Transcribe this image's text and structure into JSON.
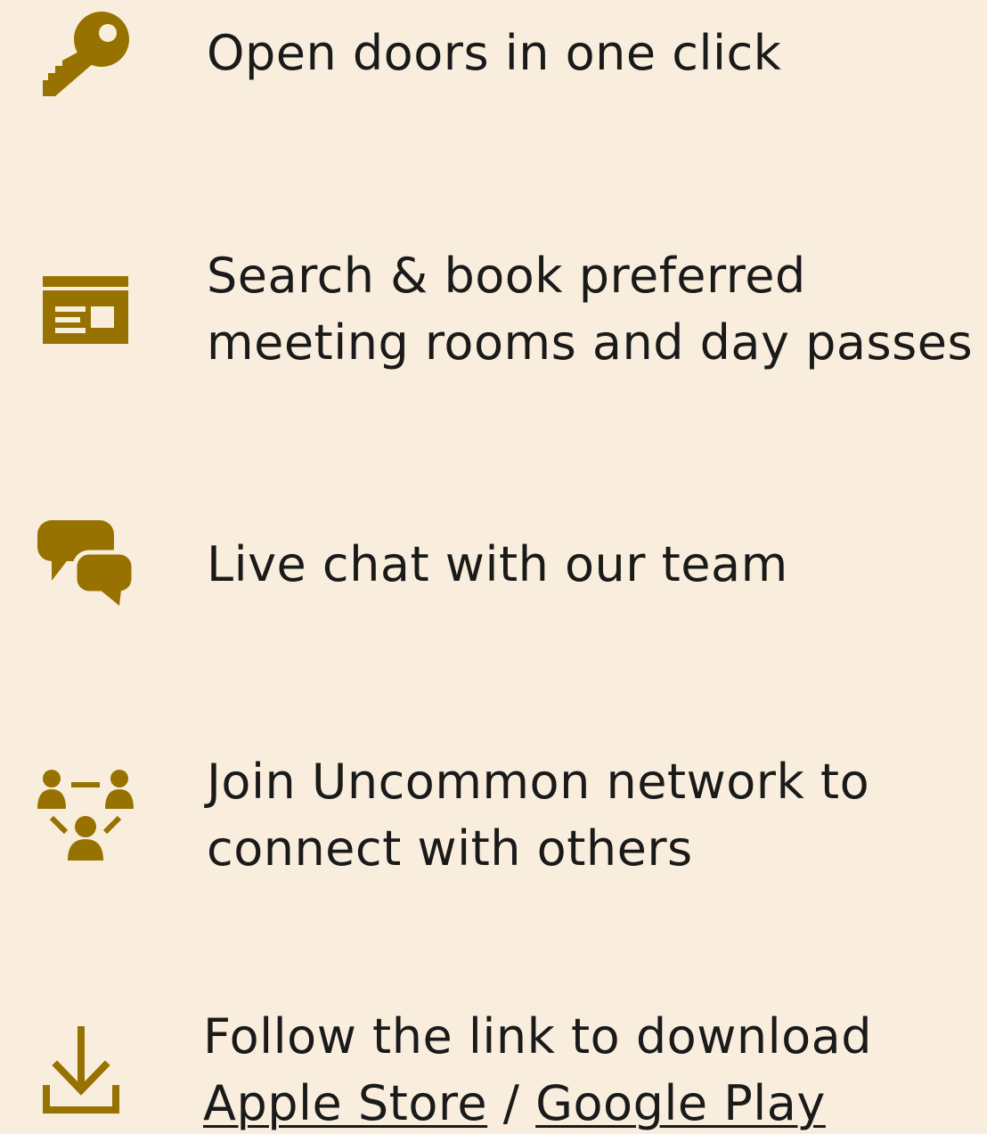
{
  "accent_color": "#977200",
  "background_color": "#f9eedd",
  "features": [
    {
      "icon": "key-icon",
      "lines": [
        "Open doors in one click"
      ]
    },
    {
      "icon": "booking-calendar-icon",
      "lines": [
        "Search & book preferred",
        "meeting rooms and day passes"
      ]
    },
    {
      "icon": "chat-bubbles-icon",
      "lines": [
        "Live chat with our team"
      ]
    },
    {
      "icon": "network-people-icon",
      "lines": [
        "Join Uncommon network to",
        "connect with others"
      ]
    },
    {
      "icon": "download-icon",
      "line1": "Follow the link to download",
      "apple_store": "Apple Store",
      "separator": " / ",
      "google_play": "Google Play"
    }
  ]
}
